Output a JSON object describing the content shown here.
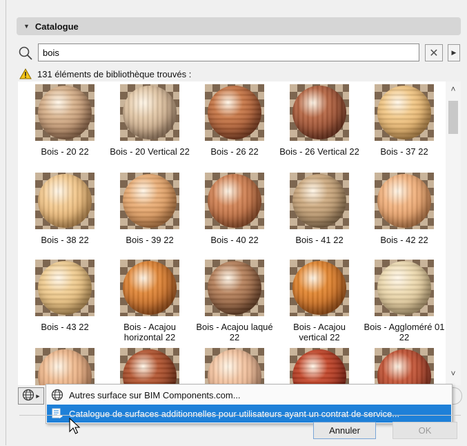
{
  "catalogue": {
    "title": "Catalogue"
  },
  "search": {
    "value": "bois"
  },
  "status": {
    "text": "131 éléments de bibliothèque trouvés :"
  },
  "items": [
    {
      "label": "Bois - 20 22",
      "colors": [
        "#d9b48f",
        "#8b5a3a"
      ]
    },
    {
      "label": "Bois - 20 Vertical 22",
      "colors": [
        "#e3c9a9",
        "#9c7658"
      ]
    },
    {
      "label": "Bois - 26 22",
      "colors": [
        "#c97a4b",
        "#7a3218"
      ]
    },
    {
      "label": "Bois - 26 Vertical 22",
      "colors": [
        "#b86a48",
        "#6b2a16"
      ]
    },
    {
      "label": "Bois - 37 22",
      "colors": [
        "#f2c98a",
        "#c88a3e"
      ]
    },
    {
      "label": "Bois - 38 22",
      "colors": [
        "#f4cc94",
        "#cf8f44"
      ]
    },
    {
      "label": "Bois - 39 22",
      "colors": [
        "#eab07a",
        "#c07436"
      ]
    },
    {
      "label": "Bois - 40 22",
      "colors": [
        "#d4875a",
        "#94461e"
      ]
    },
    {
      "label": "Bois - 41 22",
      "colors": [
        "#cfad84",
        "#8b6b46"
      ]
    },
    {
      "label": "Bois - 42 22",
      "colors": [
        "#f3b684",
        "#c8773c"
      ]
    },
    {
      "label": "Bois - 43 22",
      "colors": [
        "#f1cf96",
        "#c9964e"
      ]
    },
    {
      "label": "Bois - Acajou horizontal 22",
      "colors": [
        "#e28a3c",
        "#9c4612"
      ]
    },
    {
      "label": "Bois - Acajou laqué 22",
      "colors": [
        "#b98560",
        "#5e3218"
      ]
    },
    {
      "label": "Bois - Acajou vertical 22",
      "colors": [
        "#e48a36",
        "#a04810"
      ]
    },
    {
      "label": "Bois - Aggloméré 01 22",
      "colors": [
        "#eedcb4",
        "#c2a26c"
      ]
    },
    {
      "label": "",
      "colors": [
        "#f0bc92",
        "#c88256"
      ]
    },
    {
      "label": "",
      "colors": [
        "#b65a36",
        "#6e2810"
      ]
    },
    {
      "label": "",
      "colors": [
        "#f4c6a4",
        "#c88c68"
      ]
    },
    {
      "label": "",
      "colors": [
        "#c44a2e",
        "#7a1a10"
      ]
    },
    {
      "label": "",
      "colors": [
        "#c65a3c",
        "#7e2414"
      ]
    }
  ],
  "menu": {
    "item1": "Autres surface sur BIM Components.com...",
    "item2": "Catalogue de surfaces additionnelles pour utilisateurs ayant un contrat de service..."
  },
  "buttons": {
    "cancel": "Annuler",
    "ok": "OK"
  },
  "colors": {
    "selection": "#1e80d8",
    "warning": "#f5c518"
  }
}
